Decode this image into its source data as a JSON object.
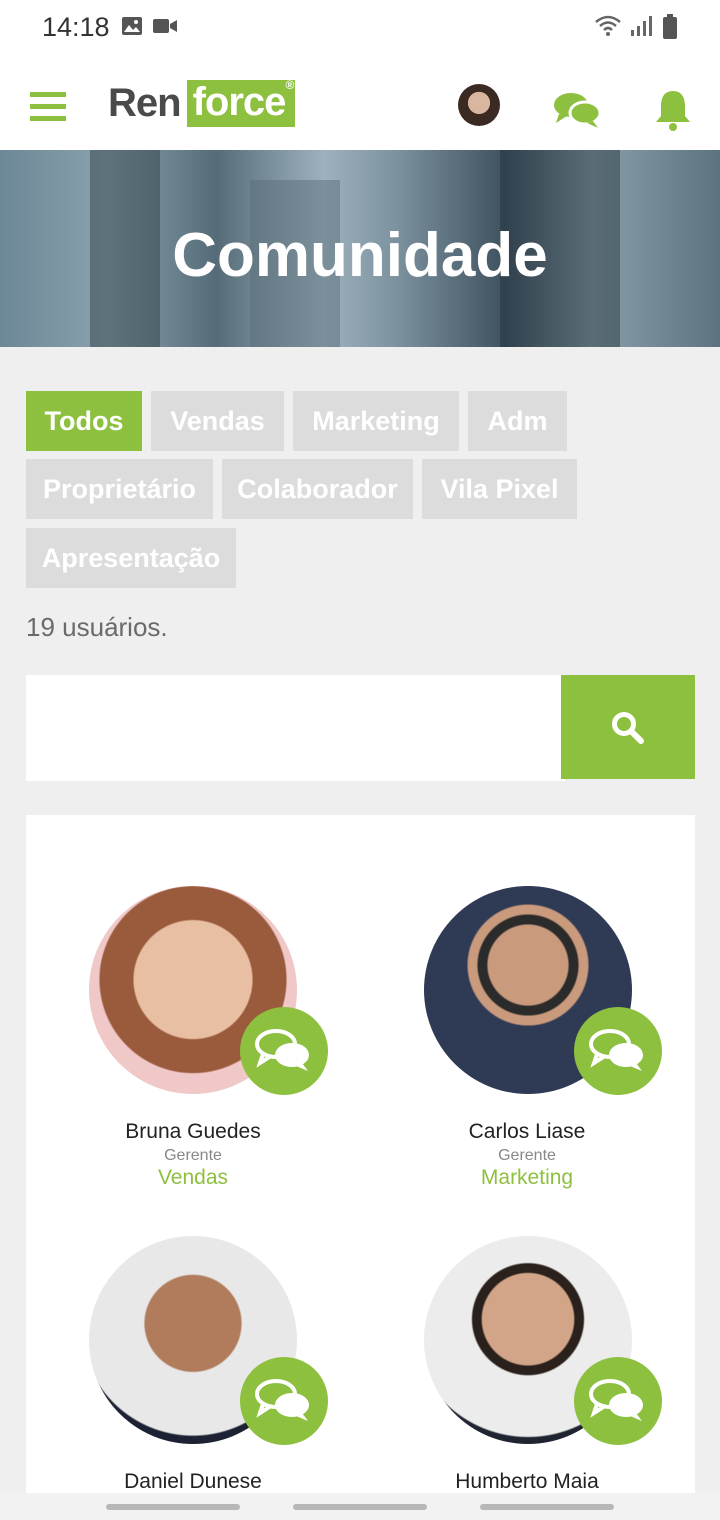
{
  "status_bar": {
    "time": "14:18"
  },
  "header": {
    "logo_ren": "Ren",
    "logo_force": "force",
    "logo_reg": "®"
  },
  "banner": {
    "title": "Comunidade"
  },
  "filters": [
    "Todos",
    "Vendas",
    "Marketing",
    "Adm",
    "Proprietário",
    "Colaborador",
    "Vila Pixel",
    "Apresentação"
  ],
  "active_filter": "Todos",
  "user_count": "19 usuários.",
  "search": {
    "placeholder": "",
    "value": ""
  },
  "people": [
    {
      "name": "Bruna Guedes",
      "role": "Gerente",
      "dept": "Vendas"
    },
    {
      "name": "Carlos Liase",
      "role": "Gerente",
      "dept": "Marketing"
    },
    {
      "name": "Daniel Dunese",
      "role": "",
      "dept": ""
    },
    {
      "name": "Humberto Maia",
      "role": "",
      "dept": ""
    }
  ],
  "colors": {
    "accent": "#8dc03f",
    "chip": "#dcdcdc",
    "background": "#efefef"
  },
  "icons": {
    "menu": "hamburger-icon",
    "messages": "chat-bubbles-icon",
    "notifications": "bell-icon",
    "search": "search-icon"
  }
}
